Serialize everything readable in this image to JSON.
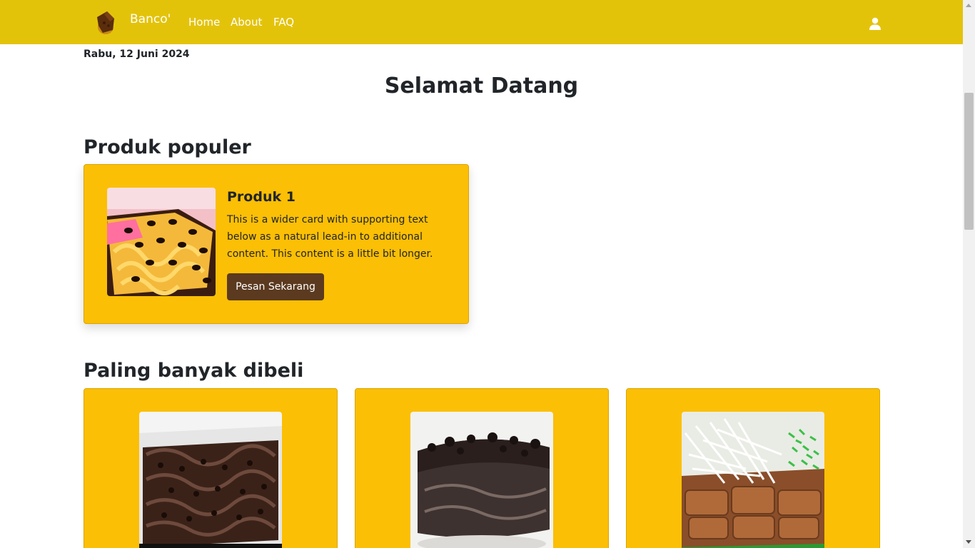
{
  "navbar": {
    "brand": "Banco'",
    "links": [
      "Home",
      "About",
      "FAQ"
    ],
    "user_icon": "user-icon",
    "logo_icon": "chocolate-bite-logo",
    "bg_color": "#e3c30a"
  },
  "date": "Rabu, 12 Juni 2024",
  "welcome_title": "Selamat Datang",
  "popular": {
    "title": "Produk populer",
    "card": {
      "name": "Produk 1",
      "description": "This is a wider card with supporting text below as a natural lead-in to additional content. This content is a little bit longer.",
      "button_label": "Pesan Sekarang"
    }
  },
  "best_sellers": {
    "title": "Paling banyak dibeli"
  },
  "colors": {
    "card_bg": "#fbbf05",
    "button_bg": "#5b3a1f"
  }
}
